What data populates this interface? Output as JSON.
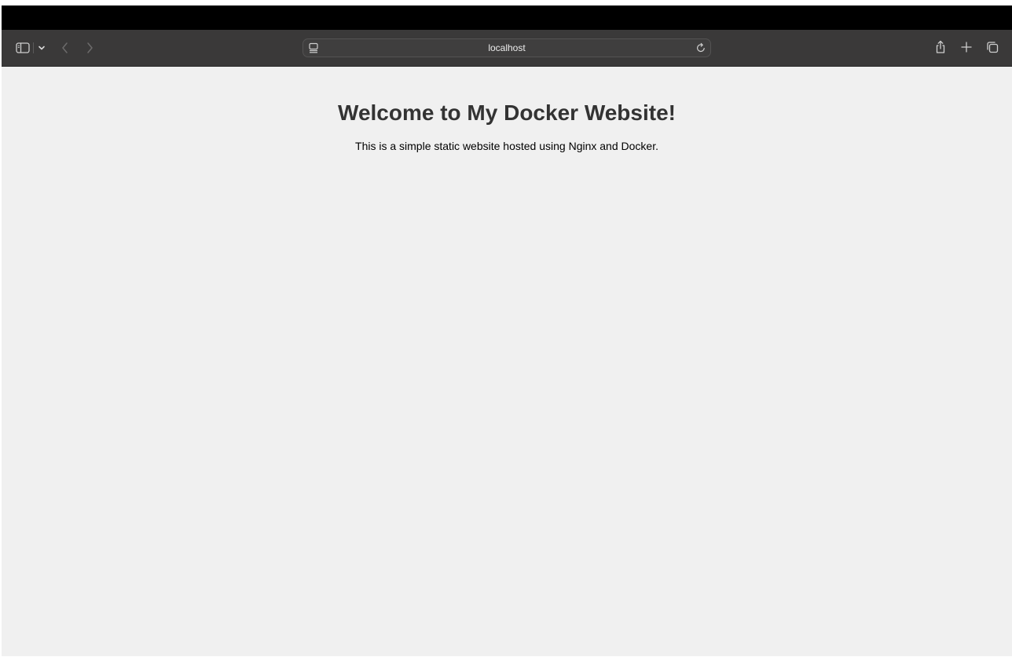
{
  "browser": {
    "address": "localhost",
    "icons": {
      "sidebar": "sidebar-icon",
      "sidebar_menu": "chevron-down-icon",
      "back": "chevron-left-icon",
      "forward": "chevron-right-icon",
      "page_settings": "page-settings-icon",
      "reload": "reload-icon",
      "share": "share-icon",
      "new_tab": "plus-icon",
      "tab_overview": "tab-overview-icon"
    }
  },
  "page": {
    "title": "Welcome to My Docker Website!",
    "description": "This is a simple static website hosted using Nginx and Docker."
  },
  "colors": {
    "toolbar": "#3a3939",
    "page_background": "#f0f0f0",
    "title_text": "#333333"
  }
}
